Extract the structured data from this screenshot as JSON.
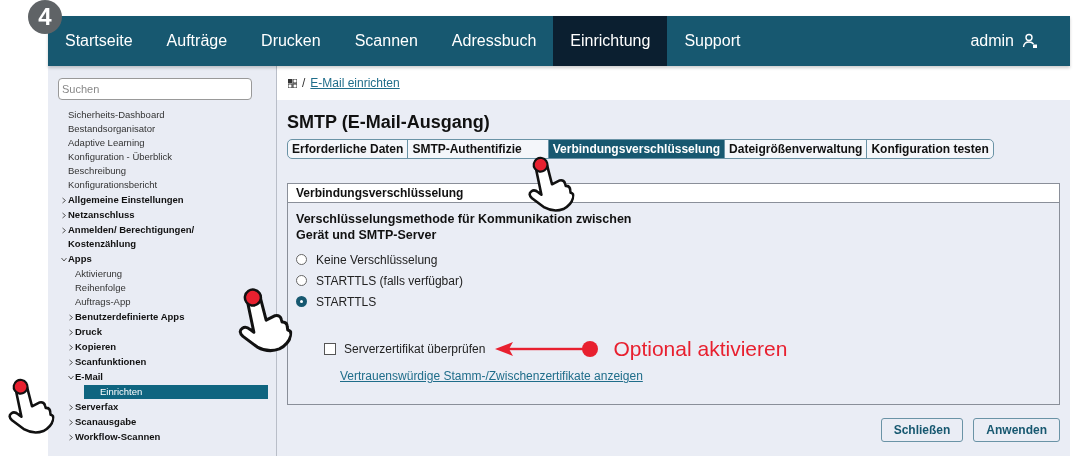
{
  "step_badge": "4",
  "nav": {
    "items": [
      {
        "label": "Startseite",
        "selected": false
      },
      {
        "label": "Aufträge",
        "selected": false
      },
      {
        "label": "Drucken",
        "selected": false
      },
      {
        "label": "Scannen",
        "selected": false
      },
      {
        "label": "Adressbuch",
        "selected": false
      },
      {
        "label": "Einrichtung",
        "selected": true
      },
      {
        "label": "Support",
        "selected": false
      }
    ],
    "user": "admin"
  },
  "sidebar": {
    "search": {
      "placeholder": "Suchen"
    },
    "items": [
      {
        "label": "Sicherheits-Dashboard",
        "kind": "leaf",
        "selected": false
      },
      {
        "label": "Bestandsorganisator",
        "kind": "leaf",
        "selected": false
      },
      {
        "label": "Adaptive Learning",
        "kind": "leaf",
        "selected": false
      },
      {
        "label": "Konfiguration - Überblick",
        "kind": "leaf",
        "selected": false
      },
      {
        "label": "Beschreibung",
        "kind": "leaf",
        "selected": false
      },
      {
        "label": "Konfigurationsbericht",
        "kind": "leaf",
        "selected": false
      },
      {
        "label": "Allgemeine Einstellungen",
        "kind": "group",
        "expanded": false
      },
      {
        "label": "Netzanschluss",
        "kind": "group",
        "expanded": false
      },
      {
        "label": "Anmelden/ Berechtigungen/ Kostenzählung",
        "kind": "group",
        "expanded": false
      },
      {
        "label": "Apps",
        "kind": "group",
        "expanded": true,
        "children": [
          {
            "label": "Aktivierung",
            "kind": "leaf",
            "selected": false
          },
          {
            "label": "Reihenfolge",
            "kind": "leaf",
            "selected": false
          },
          {
            "label": "Auftrags-App",
            "kind": "leaf",
            "selected": false
          },
          {
            "label": "Benutzerdefinierte Apps",
            "kind": "group",
            "expanded": false
          },
          {
            "label": "Druck",
            "kind": "group",
            "expanded": false
          },
          {
            "label": "Kopieren",
            "kind": "group",
            "expanded": false
          },
          {
            "label": "Scanfunktionen",
            "kind": "group",
            "expanded": false
          },
          {
            "label": "E-Mail",
            "kind": "group",
            "expanded": true,
            "children": [
              {
                "label": "Einrichten",
                "kind": "leaf",
                "selected": true
              }
            ]
          },
          {
            "label": "Serverfax",
            "kind": "group",
            "expanded": false
          },
          {
            "label": "Scanausgabe",
            "kind": "group",
            "expanded": false
          },
          {
            "label": "Workflow-Scannen",
            "kind": "group",
            "expanded": false
          }
        ]
      }
    ]
  },
  "breadcrumb": {
    "separator": "/",
    "link": "E-Mail einrichten"
  },
  "page_title": "SMTP (E-Mail-Ausgang)",
  "tabs": [
    {
      "label": "Erforderliche Daten",
      "selected": false
    },
    {
      "label": "SMTP-Authentifizie",
      "selected": false
    },
    {
      "label": "Verbindungsverschlüsselung",
      "selected": true
    },
    {
      "label": "Dateigrößenverwaltung",
      "selected": false
    },
    {
      "label": "Konfiguration testen",
      "selected": false
    }
  ],
  "panel": {
    "title": "Verbindungsverschlüsselung",
    "question": "Verschlüsselungsmethode für Kommunikation zwischen Gerät und SMTP-Server",
    "options": [
      {
        "label": "Keine Verschlüsselung",
        "selected": false
      },
      {
        "label": "STARTTLS (falls verfügbar)",
        "selected": false
      },
      {
        "label": "STARTTLS",
        "selected": true
      }
    ],
    "checkbox": {
      "label": "Serverzertifikat überprüfen",
      "checked": false
    },
    "link": "Vertrauenswürdige Stamm-/Zwischenzertifikate anzeigen"
  },
  "annotation": {
    "text": "Optional aktivieren"
  },
  "buttons": [
    "Schließen",
    "Anwenden"
  ]
}
